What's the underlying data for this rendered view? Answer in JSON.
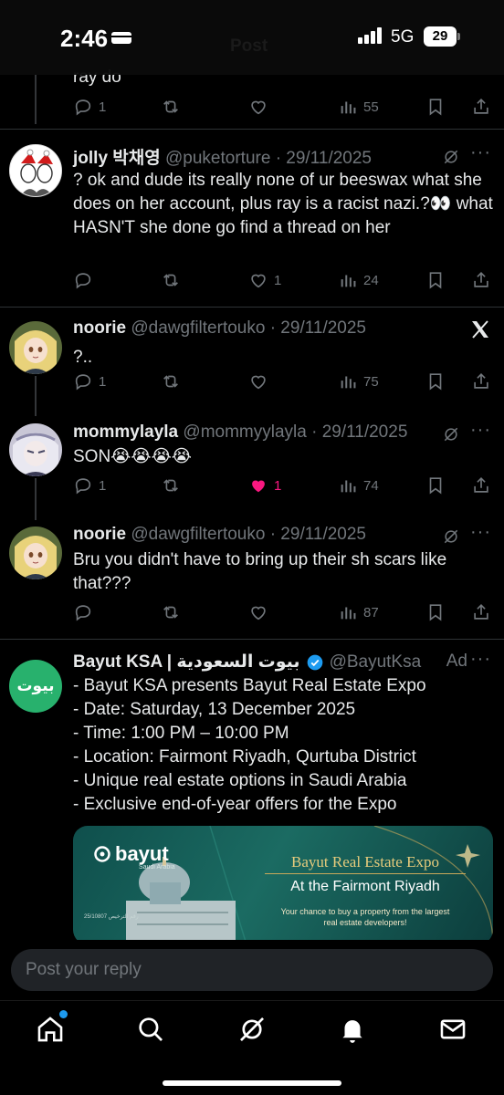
{
  "status_bar": {
    "time": "2:46",
    "network": "5G",
    "battery": "29"
  },
  "header": {
    "title": "Post"
  },
  "tweets": [
    {
      "text": "ray do",
      "replies": "1",
      "retweets": "",
      "likes": "",
      "views": "55"
    },
    {
      "name": "jolly 박채영",
      "meta": "@puketorture · 29/11/2025",
      "text": "? ok and dude its really none of ur beeswax what she does on her account, plus ray is a racist nazi.?👀 what HASN'T she done go find a thread on her",
      "replies": "",
      "retweets": "",
      "likes": "1",
      "views": "24"
    },
    {
      "name": "noorie",
      "meta": "@dawgfiltertouko · 29/11/2025",
      "text": "?..",
      "replies": "1",
      "retweets": "",
      "likes": "",
      "views": "75"
    },
    {
      "name": "mommylayla",
      "meta": "@mommyylayla · 29/11/2025",
      "text": "SON😭😭😭😭",
      "replies": "1",
      "retweets": "",
      "likes": "1",
      "views": "74"
    },
    {
      "name": "noorie",
      "meta": "@dawgfiltertouko · 29/11/2025",
      "text": "Bru you didn't have to bring up their sh scars like that???",
      "replies": "",
      "retweets": "",
      "likes": "",
      "views": "87"
    }
  ],
  "ad": {
    "name": "Bayut KSA | بيوت السعودية",
    "handle": "@BayutKsa",
    "label": "Ad",
    "avatar_text": "بيوت",
    "lines": [
      "- Bayut KSA presents Bayut Real Estate Expo",
      "- Date: Saturday, 13 December 2025",
      "- Time: 1:00 PM – 10:00 PM",
      "- Location: Fairmont Riyadh, Qurtuba District",
      "- Unique real estate options in Saudi Arabia",
      "- Exclusive end-of-year offers for the Expo"
    ],
    "card": {
      "brand": "bayut",
      "brand_sub": "Saudi Arabia",
      "title": "Bayut Real Estate Expo",
      "subtitle": "At the Fairmont Riyadh",
      "tagline": "Your chance to buy a property from the largest real estate developers!",
      "license": "25/10807 رقم الترخيص"
    }
  },
  "reply_input": {
    "placeholder": "Post your reply"
  },
  "colors": {
    "background": "#000000",
    "like_active": "#f91880",
    "ad_green": "#28b16d",
    "verified": "#1d9bf0"
  },
  "tabbar": {
    "items": [
      "home",
      "search",
      "grok",
      "notifications",
      "messages"
    ],
    "home_unread": true
  }
}
